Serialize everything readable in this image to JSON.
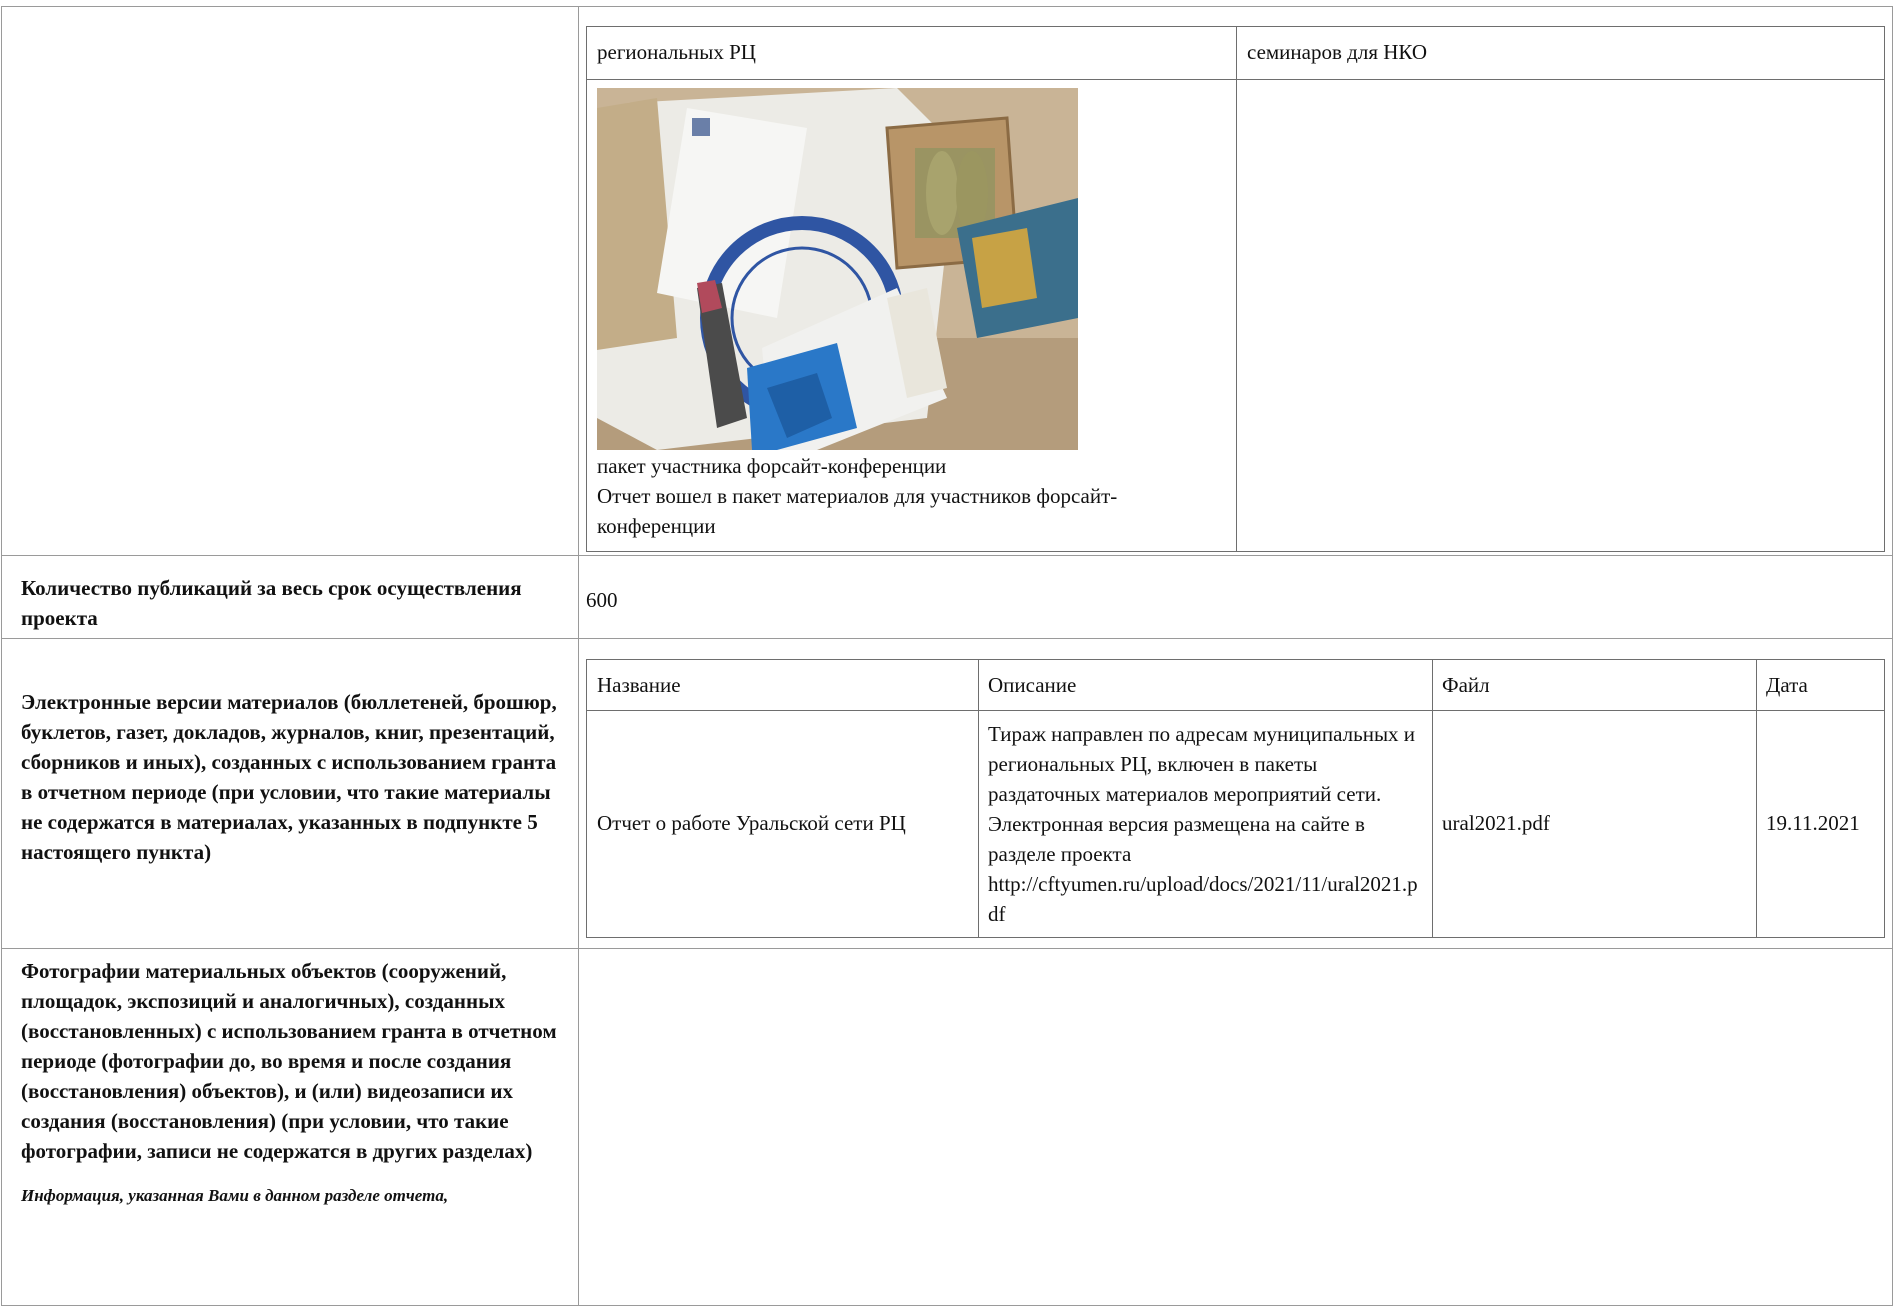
{
  "top_table": {
    "col1_header": "региональных РЦ",
    "col2_header": "семинаров для НКО",
    "photo_caption": "пакет участника форсайт-конференции",
    "photo_description": "Отчет вошел в пакет материалов для участников форсайт-конференции"
  },
  "publications": {
    "label": "Количество публикаций за весь срок осуществления проекта",
    "value": "600"
  },
  "electronic": {
    "label": "Электронные версии материалов (бюллетеней, брошюр, буклетов, газет, докладов, журналов, книг, презентаций, сборников и иных), созданных с использованием гранта в отчетном периоде (при условии, что такие материалы не содержатся в материалах, указанных в подпункте 5 настоящего пункта)",
    "columns": [
      "Название",
      "Описание",
      "Файл",
      "Дата"
    ],
    "rows": [
      {
        "name": "Отчет о работе Уральской сети РЦ",
        "description": "Тираж направлен по адресам муниципальных и региональных РЦ, включен в пакеты раздаточных материалов мероприятий сети. Электронная версия размещена на сайте в разделе проекта http://cftyumen.ru/upload/docs/2021/11/ural2021.pdf",
        "file": "ural2021.pdf",
        "date": "19.11.2021"
      }
    ]
  },
  "photos": {
    "label": "Фотографии материальных объектов (сооружений, площадок, экспозиций и аналогичных), созданных (восстановленных) с использованием гранта в отчетном периоде (фотографии до, во время и после создания (восстановления) объектов), и (или) видеозаписи их создания (восстановления) (при условии, что такие фотографии, записи не содержатся в других разделах)",
    "note": "Информация, указанная Вами в данном разделе отчета,"
  }
}
